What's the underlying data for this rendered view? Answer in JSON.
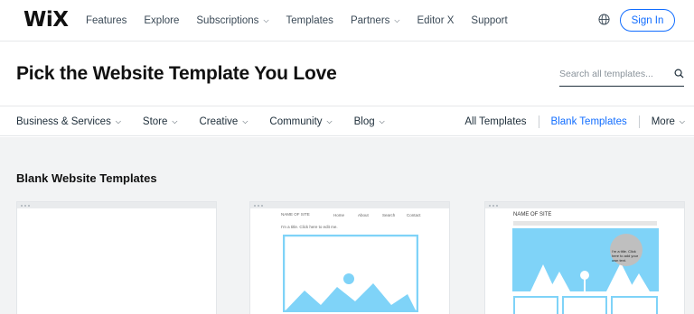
{
  "nav": {
    "logo": "WiX",
    "items": [
      {
        "label": "Features",
        "has_chevron": false
      },
      {
        "label": "Explore",
        "has_chevron": false
      },
      {
        "label": "Subscriptions",
        "has_chevron": true
      },
      {
        "label": "Templates",
        "has_chevron": false
      },
      {
        "label": "Partners",
        "has_chevron": true
      },
      {
        "label": "Editor X",
        "has_chevron": false
      },
      {
        "label": "Support",
        "has_chevron": false
      }
    ],
    "sign_in_label": "Sign In",
    "language_icon": "globe-icon"
  },
  "header": {
    "title": "Pick the Website Template You Love",
    "search_placeholder": "Search all templates...",
    "search_icon": "search-icon"
  },
  "categories": {
    "left": [
      {
        "label": "Business & Services"
      },
      {
        "label": "Store"
      },
      {
        "label": "Creative"
      },
      {
        "label": "Community"
      },
      {
        "label": "Blog"
      }
    ],
    "all_templates": "All Templates",
    "blank_templates": "Blank Templates",
    "more": "More"
  },
  "gallery": {
    "section_title": "Blank Website Templates",
    "cards": [
      {
        "name": "blank-template-1"
      },
      {
        "name": "blank-template-2",
        "site_name": "NAME OF SITE",
        "intro": "I'm a title. Click here to edit me.",
        "menu": [
          "Home",
          "About",
          "Search",
          "Contact"
        ]
      },
      {
        "name": "blank-template-3",
        "site_name": "NAME OF SITE",
        "bubble_text": "I'm a title. Click here to add your own text."
      }
    ]
  },
  "colors": {
    "accent": "#116dff",
    "placeholder_blue": "#7fd3f8",
    "gallery_bg": "#f2f3f4"
  }
}
